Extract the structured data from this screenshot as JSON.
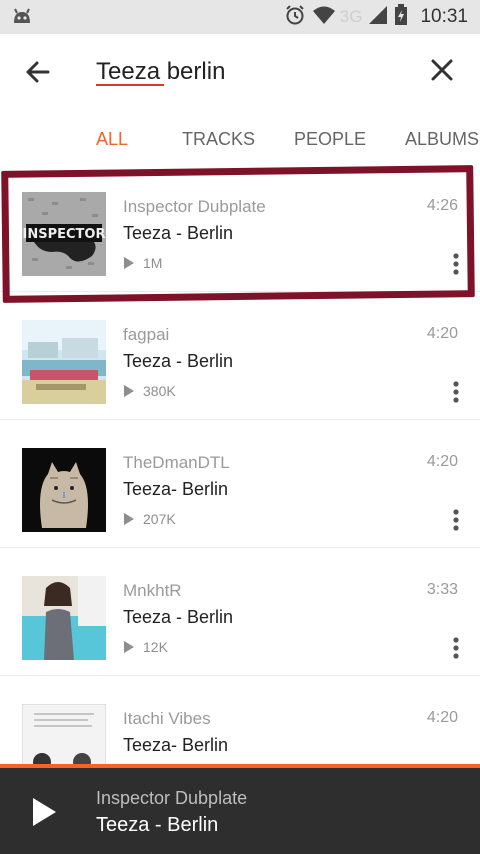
{
  "status_bar": {
    "time": "10:31",
    "network": "3G",
    "icons": [
      "android-icon",
      "alarm-icon",
      "wifi-icon",
      "signal-icon",
      "battery-icon"
    ]
  },
  "search": {
    "query": "Teeza berlin",
    "back_icon": "arrow-left-icon",
    "clear_icon": "close-icon"
  },
  "tabs": [
    {
      "label": "ALL",
      "active": true
    },
    {
      "label": "TRACKS",
      "active": false
    },
    {
      "label": "PEOPLE",
      "active": false
    },
    {
      "label": "ALBUMS",
      "active": false
    }
  ],
  "tracks": [
    {
      "uploader": "Inspector Dubplate",
      "title": "Teeza - Berlin",
      "duration": "4:26",
      "plays": "1M",
      "artwork_text": "INSPECTOR"
    },
    {
      "uploader": "fagpai",
      "title": "Teeza - Berlin",
      "duration": "4:20",
      "plays": "380K"
    },
    {
      "uploader": "TheDmanDTL",
      "title": "Teeza- Berlin",
      "duration": "4:20",
      "plays": "207K"
    },
    {
      "uploader": "MnkhtR",
      "title": "Teeza - Berlin",
      "duration": "3:33",
      "plays": "12K"
    },
    {
      "uploader": "Itachi Vibes",
      "title": "Teeza- Berlin",
      "duration": "4:20",
      "plays": ""
    }
  ],
  "mini_player": {
    "uploader": "Inspector Dubplate",
    "title": "Teeza - Berlin",
    "play_icon": "play-icon"
  },
  "colors": {
    "accent": "#f26522",
    "highlight": "#7d1228",
    "player_bg": "#2e2e2e",
    "status_bg": "#e6e6e6"
  }
}
